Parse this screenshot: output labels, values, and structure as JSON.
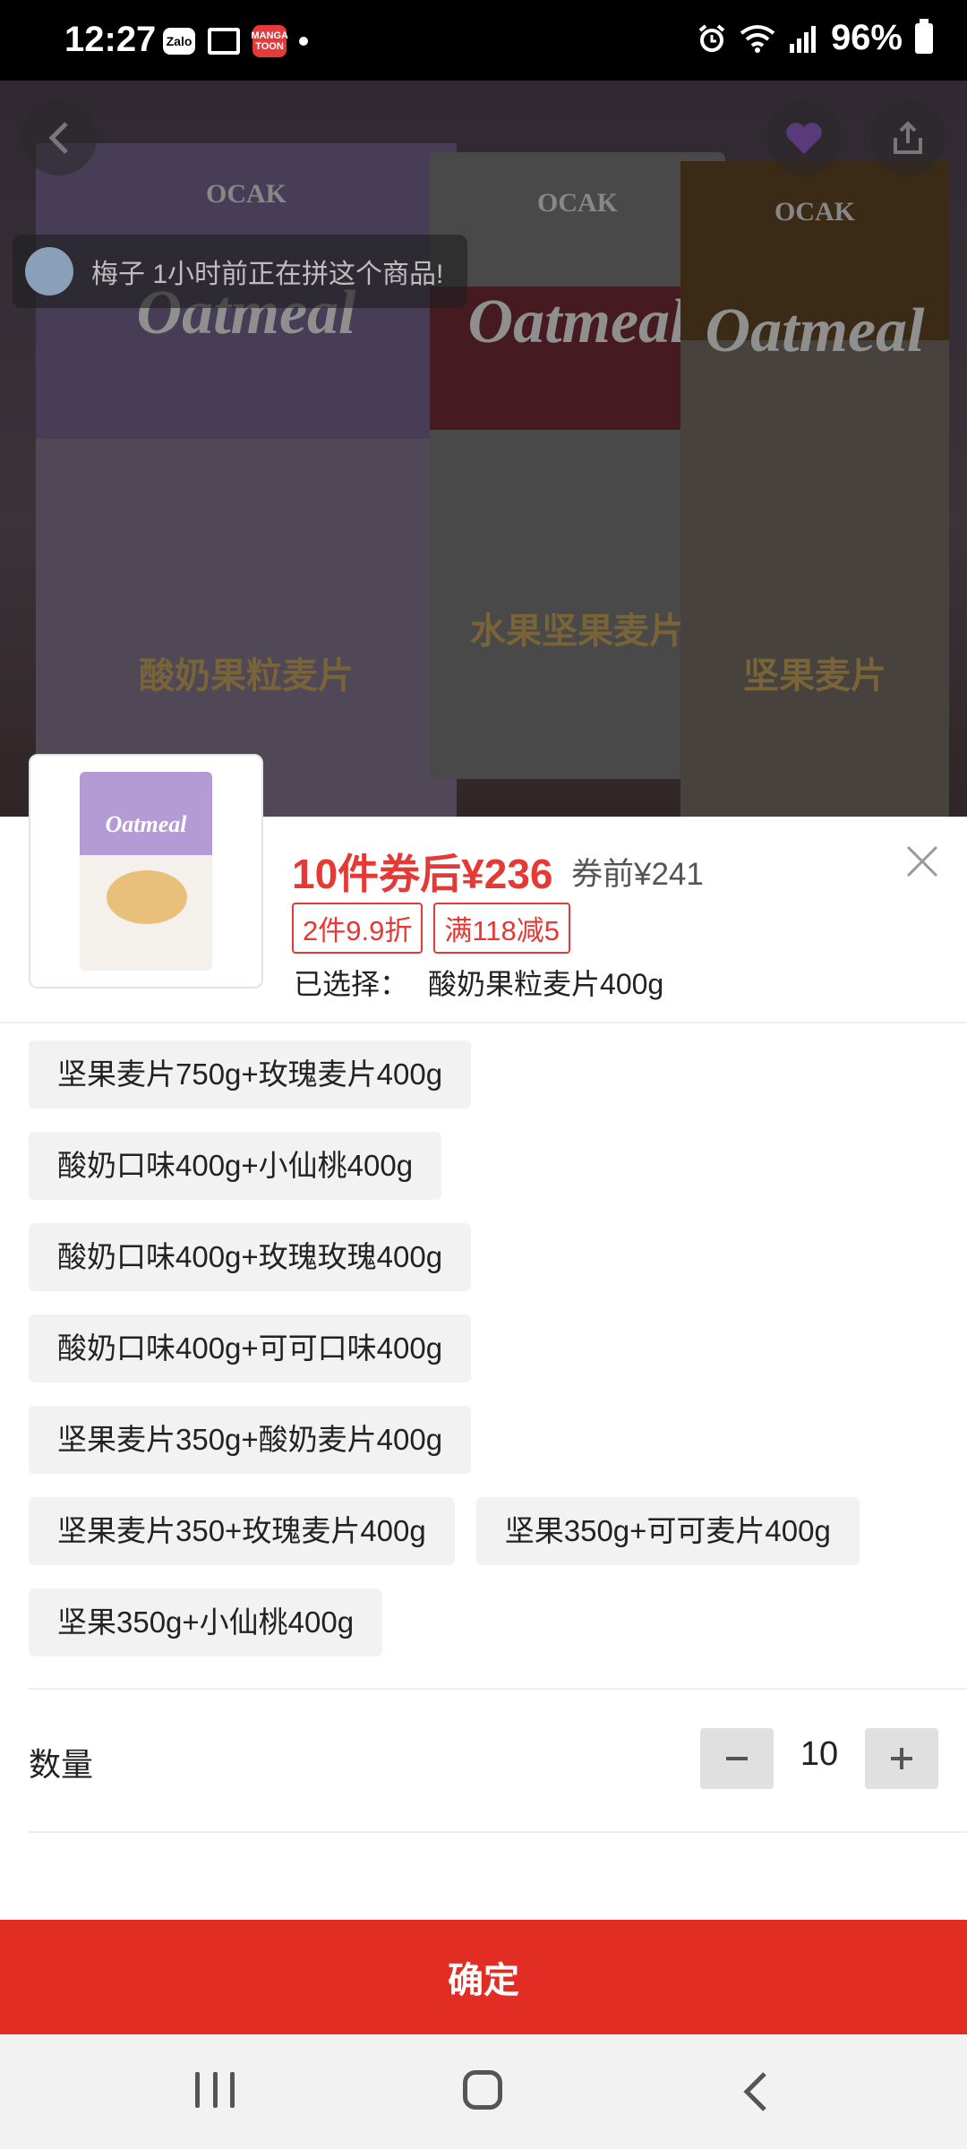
{
  "status_bar": {
    "time": "12:27",
    "left_icons": [
      "zalo-icon",
      "monitor-icon",
      "manga-toon-icon",
      "dot"
    ],
    "zalo_label": "Zalo",
    "manga_label": "MANGA TOON",
    "battery": "96%"
  },
  "hero": {
    "group_notice": "梅子 1小时前正在拼这个商品!",
    "bags": [
      {
        "brand": "OCAK",
        "title": "Oatmeal",
        "subtitle": "酸奶果粒麦片"
      },
      {
        "brand": "OCAK",
        "title": "Oatmeal",
        "subtitle": "水果坚果麦片"
      },
      {
        "brand": "OCAK",
        "title": "Oatmeal",
        "subtitle": "坚果麦片"
      }
    ]
  },
  "sheet": {
    "price_main": "10件券后¥236",
    "price_before": "券前¥241",
    "tags": [
      "2件9.9折",
      "满118减5"
    ],
    "selected_label": "已选择：",
    "selected_value": "酸奶果粒麦片400g",
    "options": [
      [
        "坚果麦片750g+玫瑰麦片400g"
      ],
      [
        "酸奶口味400g+小仙桃400g"
      ],
      [
        "酸奶口味400g+玫瑰玫瑰400g"
      ],
      [
        "酸奶口味400g+可可口味400g"
      ],
      [
        "坚果麦片350g+酸奶麦片400g"
      ],
      [
        "坚果麦片350+玫瑰麦片400g",
        "坚果350g+可可麦片400g"
      ],
      [
        "坚果350g+小仙桃400g"
      ]
    ],
    "quantity_label": "数量",
    "quantity_value": "10",
    "confirm_label": "确定"
  },
  "colors": {
    "accent": "#e22d25",
    "price": "#e53935"
  }
}
